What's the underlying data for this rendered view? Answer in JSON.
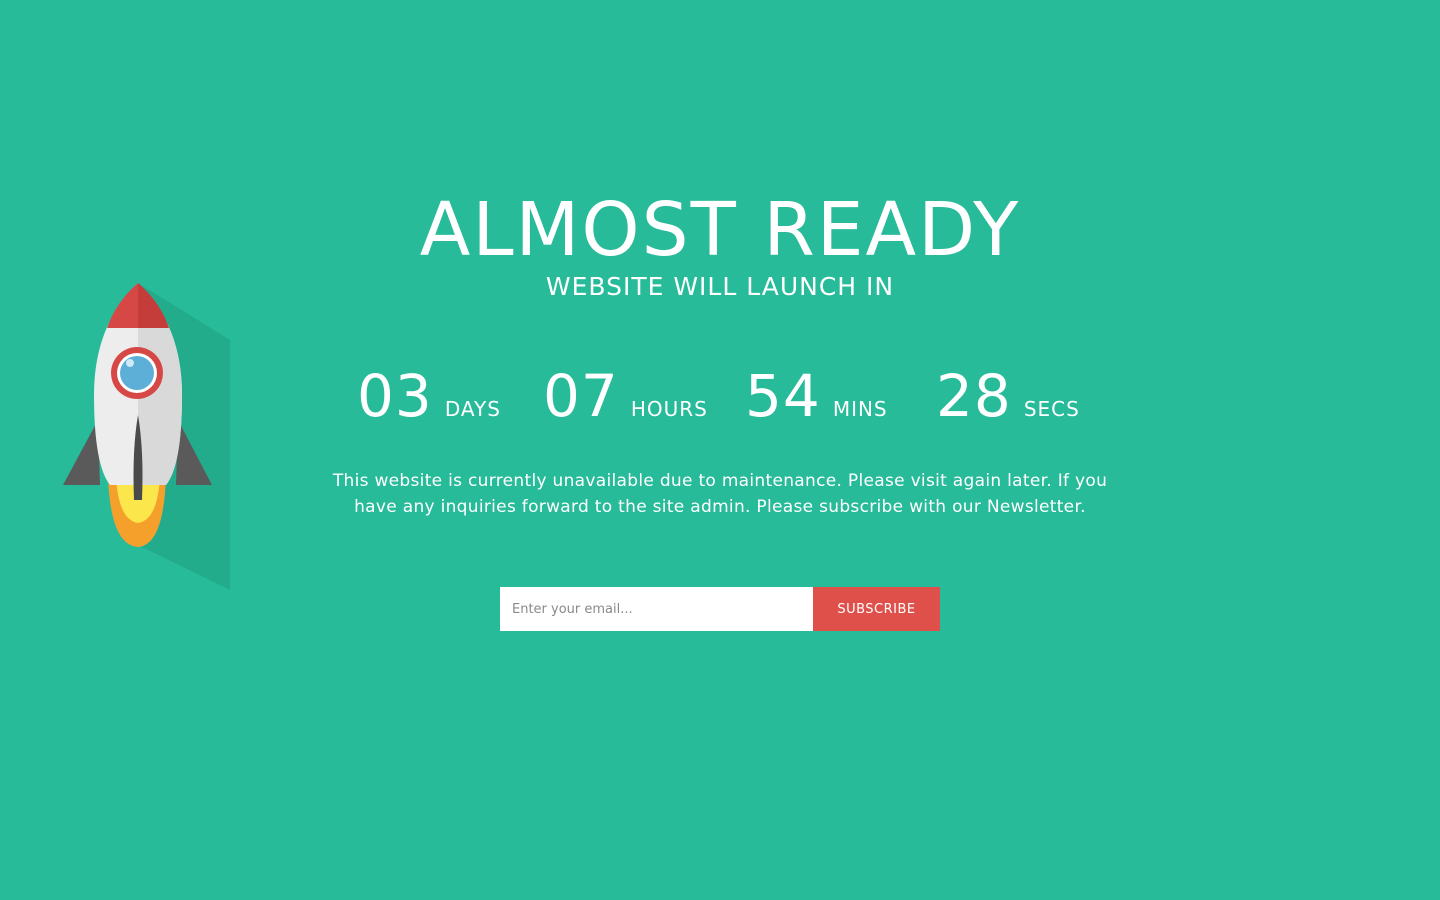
{
  "page": {
    "background_color": "#27bb9a",
    "accent_color": "#e0504b"
  },
  "hero": {
    "title": "ALMOST READY",
    "subtitle": "WEBSITE WILL LAUNCH IN"
  },
  "countdown": [
    {
      "value": "03",
      "label": "DAYS"
    },
    {
      "value": "07",
      "label": "HOURS"
    },
    {
      "value": "54",
      "label": "MINS"
    },
    {
      "value": "28",
      "label": "SECS"
    }
  ],
  "message": "This website is currently unavailable due to maintenance. Please visit again later. If you have any inquiries forward to the site admin. Please subscribe with our Newsletter.",
  "subscribe": {
    "placeholder": "Enter your email...",
    "button_label": "SUBSCRIBE"
  },
  "illustration": {
    "icon": "rocket-icon"
  }
}
